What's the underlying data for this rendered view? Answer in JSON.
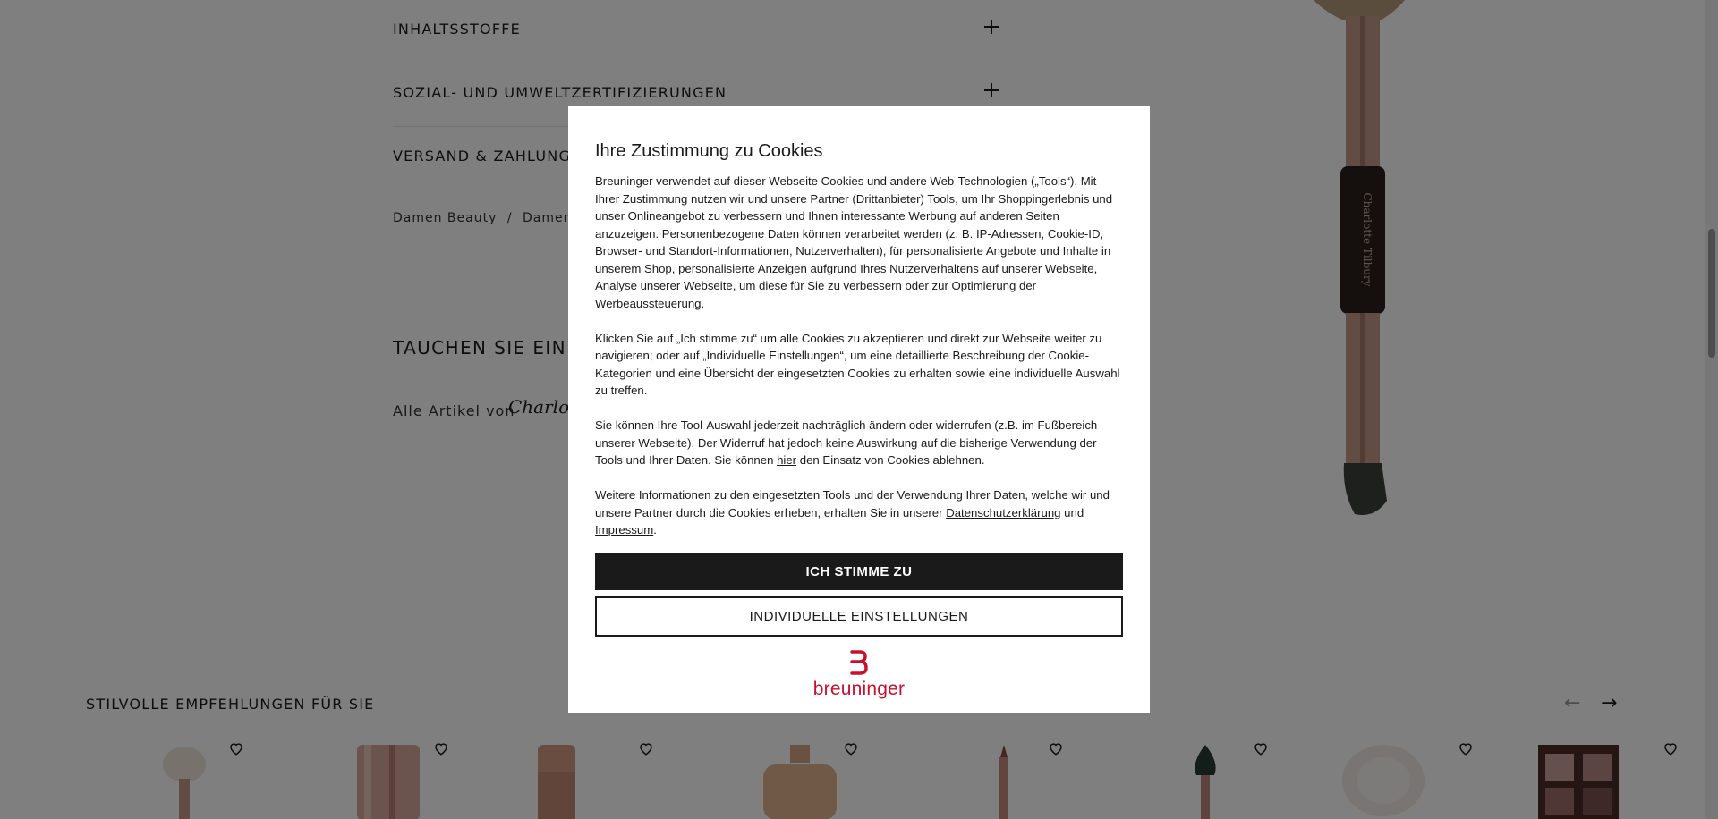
{
  "accordion": {
    "items": [
      {
        "label": "INHALTSSTOFFE"
      },
      {
        "label": "SOZIAL- UND UMWELTZERTIFIZIERUNGEN"
      },
      {
        "label": "VERSAND & ZAHLUNGSA"
      }
    ]
  },
  "breadcrumb": {
    "items": [
      "Damen Beauty",
      "/",
      "Damen M"
    ]
  },
  "dive_section": {
    "title": "TAUCHEN SIE EIN IN",
    "all_articles": "Alle Artikel von",
    "brand": "Charlotte"
  },
  "hero": {
    "brush_brand": "Charlotte Tilbury"
  },
  "recommendations": {
    "title": "STILVOLLE EMPFEHLUNGEN FÜR SIE",
    "prev_icon": "arrow-left-icon",
    "next_icon": "arrow-right-icon",
    "products": [
      {
        "type": "brush-blush",
        "icon": "heart-icon"
      },
      {
        "type": "foundation-bottle",
        "icon": "heart-icon"
      },
      {
        "type": "stick",
        "icon": "heart-icon"
      },
      {
        "type": "pump-bottle",
        "icon": "heart-icon"
      },
      {
        "type": "lip-pencil",
        "icon": "heart-icon"
      },
      {
        "type": "brush-eye",
        "icon": "heart-icon"
      },
      {
        "type": "brush-powder",
        "icon": "heart-icon"
      },
      {
        "type": "palette",
        "icon": "heart-icon"
      }
    ]
  },
  "modal": {
    "title": "Ihre Zustimmung zu Cookies",
    "p1": "Breuninger verwendet auf dieser Webseite Cookies und andere Web-Technologien („Tools“). Mit Ihrer Zustimmung nutzen wir und unsere Partner (Drittanbieter) Tools, um Ihr Shoppingerlebnis und unser Onlineangebot zu verbessern und Ihnen interessante Werbung auf anderen Seiten anzuzeigen. Personenbezogene Daten können verarbeitet werden (z. B. IP-Adressen, Cookie-ID, Browser- und Standort-Informationen, Nutzerverhalten), für personalisierte Angebote und Inhalte in unserem Shop, personalisierte Anzeigen aufgrund Ihres Nutzerverhaltens auf unserer Webseite, Analyse unserer Webseite, um diese für Sie zu verbessern oder zur Optimierung der Werbeaussteuerung.",
    "p2": "Klicken Sie auf „Ich stimme zu“ um alle Cookies zu akzeptieren und direkt zur Webseite weiter zu navigieren; oder auf „Individuelle Einstellungen“, um eine detaillierte Beschreibung der Cookie-Kategorien und eine Übersicht der eingesetzten Cookies zu erhalten sowie eine individuelle Auswahl zu treffen.",
    "p3_before": "Sie können Ihre Tool-Auswahl jederzeit nachträglich ändern oder widerrufen (z.B. im Fußbereich unserer Webseite). Der Widerruf hat jedoch keine Auswirkung auf die bisherige Verwendung der Tools und Ihrer Daten. Sie können ",
    "p3_link": "hier",
    "p3_after": " den Einsatz von Cookies ablehnen.",
    "p4_before": "Weitere Informationen zu den eingesetzten Tools und der Verwendung Ihrer Daten, welche wir und unsere Partner durch die Cookies erheben, erhalten Sie in unserer ",
    "p4_link1": "Datenschutzerklärung",
    "p4_mid": " und ",
    "p4_link2": "Impressum",
    "p4_after": ".",
    "accept_label": "ICH STIMME ZU",
    "settings_label": "INDIVIDUELLE EINSTELLUNGEN",
    "logo_text": "breuninger",
    "brand_color": "#c8102e"
  }
}
